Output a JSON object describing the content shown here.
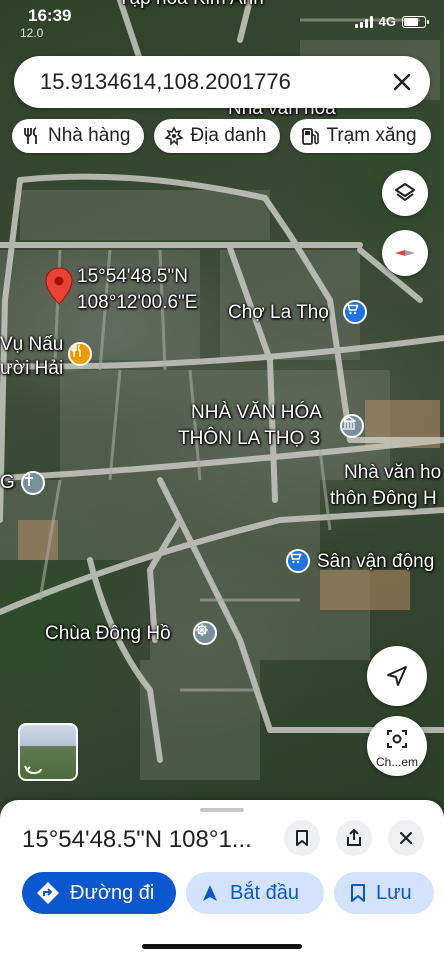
{
  "status_bar": {
    "time": "16:39",
    "sub_text": "12.0",
    "network": "4G"
  },
  "search": {
    "value": "15.9134614,108.2001776"
  },
  "chips": [
    {
      "label": "Nhà hàng",
      "icon": "restaurant-icon"
    },
    {
      "label": "Địa danh",
      "icon": "landmark-icon"
    },
    {
      "label": "Trạm xăng",
      "icon": "gas-station-icon"
    }
  ],
  "map": {
    "pin_coords_lat": "15°54'48.5\"N",
    "pin_coords_lng": "108°12'00.6\"E",
    "top_place": "Tạp hóa Kim Anh",
    "places": {
      "cho_la_tho": "Chợ La Thọ",
      "restaurant_line1": "Vụ Nấu",
      "restaurant_line2": "ười Hải",
      "nha_van_hoa_line1": "NHÀ VĂN HÓA",
      "nha_van_hoa_line2": "THÔN LA THỌ 3",
      "nha_van_hoa_2_line1": "Nhà văn ho",
      "nha_van_hoa_2_line2": "thôn Đông H",
      "san_van_dong": "Sân vận động",
      "chua_dong_ho": "Chùa Đông Hồ",
      "church_partial": "G",
      "nha_van_hoa_top": "Nhà văn hóa"
    }
  },
  "camera_caption": "Ch...em",
  "sheet": {
    "title": "15°54'48.5\"N 108°1...",
    "actions": {
      "directions": "Đường đi",
      "start": "Bắt đầu",
      "save": "Lưu"
    }
  },
  "colors": {
    "primary": "#0b57d0",
    "secondary_bg": "#d3e3fd",
    "pin_red": "#ea4335",
    "shopping_blue": "#1a73e8",
    "food_orange": "#f29900",
    "place_grey": "#78909c"
  }
}
